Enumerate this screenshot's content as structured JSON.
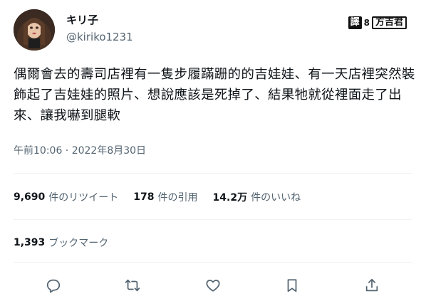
{
  "author": {
    "display_name": "キリ子",
    "handle": "@kiriko1231"
  },
  "watermark": {
    "prefix": "譯",
    "separator": "8",
    "name": "方吉君"
  },
  "tweet": {
    "text": "偶爾會去的壽司店裡有一隻步履蹣跚的的吉娃娃、有一天店裡突然裝飾起了吉娃娃的照片、想說應該是死掉了、結果牠就從裡面走了出來、讓我嚇到腿軟",
    "timestamp": "午前10:06 · 2022年8月30日"
  },
  "stats": {
    "retweets": {
      "count": "9,690",
      "label": "件のリツイート"
    },
    "quotes": {
      "count": "178",
      "label": "件の引用"
    },
    "likes": {
      "count": "14.2万",
      "label": "件のいいね"
    },
    "bookmarks": {
      "count": "1,393",
      "label": "ブックマーク"
    }
  },
  "actions": [
    {
      "icon": "reply-icon"
    },
    {
      "icon": "retweet-icon"
    },
    {
      "icon": "like-icon"
    },
    {
      "icon": "bookmark-icon"
    },
    {
      "icon": "share-icon"
    }
  ],
  "colors": {
    "text_primary": "#0f1419",
    "text_secondary": "#536471",
    "divider": "#eff3f4",
    "icon": "#536471"
  }
}
